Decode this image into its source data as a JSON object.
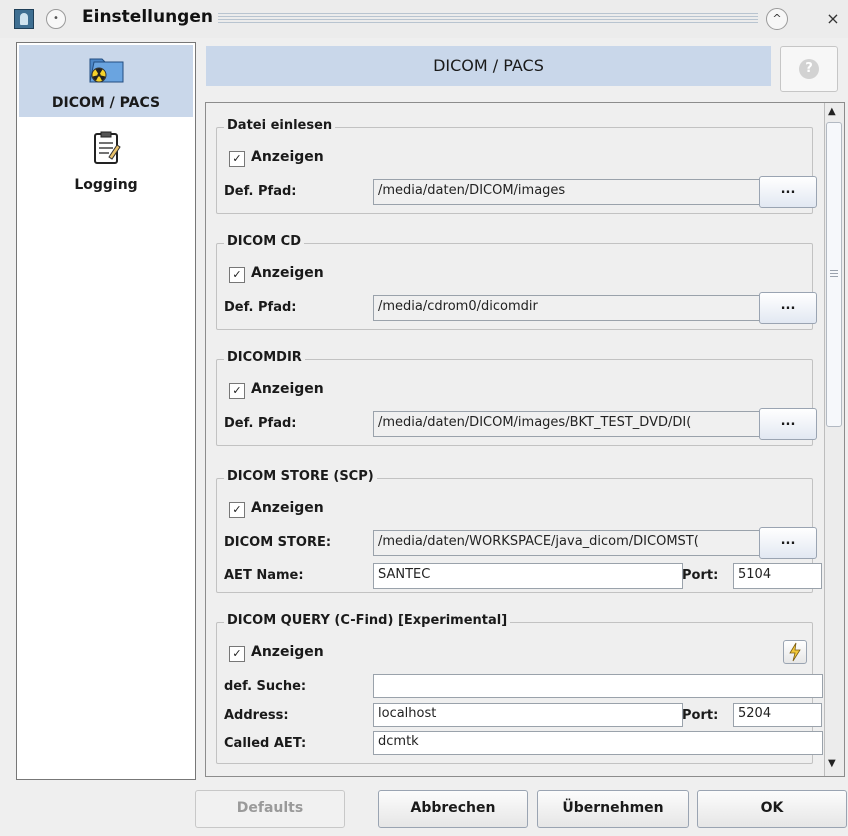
{
  "window": {
    "title": "Einstellungen",
    "pin_symbol": "•",
    "up_symbol": "^",
    "close_symbol": "×"
  },
  "sidebar": {
    "items": [
      {
        "label": "DICOM / PACS",
        "icon": "folder-radiation-icon",
        "selected": true
      },
      {
        "label": "Logging",
        "icon": "clipboard-icon",
        "selected": false
      }
    ]
  },
  "header": {
    "title": "DICOM / PACS",
    "help_symbol": "?"
  },
  "groups": {
    "datei": {
      "title": "Datei einlesen",
      "show_label": "Anzeigen",
      "show_checked": true,
      "path_label": "Def. Pfad:",
      "path_value": "/media/daten/DICOM/images",
      "browse_label": "..."
    },
    "cd": {
      "title": "DICOM CD",
      "show_label": "Anzeigen",
      "show_checked": true,
      "path_label": "Def. Pfad:",
      "path_value": "/media/cdrom0/dicomdir",
      "browse_label": "..."
    },
    "dicomdir": {
      "title": "DICOMDIR",
      "show_label": "Anzeigen",
      "show_checked": true,
      "path_label": "Def. Pfad:",
      "path_value": "/media/daten/DICOM/images/BKT_TEST_DVD/DI(",
      "browse_label": "..."
    },
    "store": {
      "title": "DICOM STORE (SCP)",
      "show_label": "Anzeigen",
      "show_checked": true,
      "store_label": "DICOM STORE:",
      "store_value": "/media/daten/WORKSPACE/java_dicom/DICOMST(",
      "browse_label": "...",
      "aet_label": "AET Name:",
      "aet_value": "SANTEC",
      "port_label": "Port:",
      "port_value": "5104"
    },
    "query": {
      "title": "DICOM QUERY (C-Find) [Experimental]",
      "show_label": "Anzeigen",
      "show_checked": true,
      "search_label": "def. Suche:",
      "search_value": "",
      "address_label": "Address:",
      "address_value": "localhost",
      "port_label": "Port:",
      "port_value": "5204",
      "called_label": "Called AET:",
      "called_value": "dcmtk",
      "test_icon": "lightning-icon"
    }
  },
  "scrollbar": {
    "up_symbol": "▲",
    "down_symbol": "▼"
  },
  "buttons": {
    "defaults": "Defaults",
    "cancel": "Abbrechen",
    "apply": "Übernehmen",
    "ok": "OK"
  },
  "check_glyph": "✓",
  "colors": {
    "selection": "#c9d7ea",
    "background": "#efefef"
  }
}
